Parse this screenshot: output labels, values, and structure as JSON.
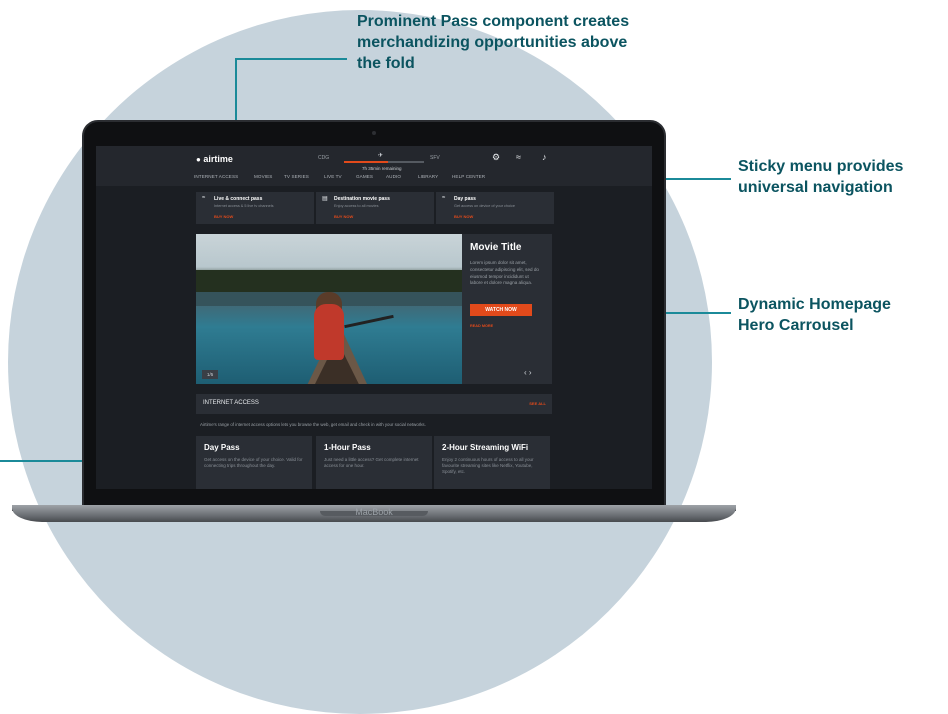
{
  "callouts": {
    "prominent_pass": [
      "Prominent Pass component creates",
      "merchandizing opportunities above",
      "the fold"
    ],
    "sticky_menu": [
      "Sticky menu provides",
      "universal navigation"
    ],
    "hero": [
      "Dynamic Homepage",
      "Hero Carrousel"
    ]
  },
  "laptop": {
    "brand": "MacBook"
  },
  "header": {
    "logo": "airtime",
    "flight": {
      "origin": "CDG",
      "destination": "SFV",
      "remaining": "7h 35min remaining",
      "progress": 0.55
    },
    "icons": [
      "gear-icon",
      "wifi-icon",
      "music-icon"
    ]
  },
  "nav": [
    "INTERNET ACCESS",
    "MOVIES",
    "TV SERIES",
    "LIVE TV",
    "GAMES",
    "AUDIO",
    "LIBRARY",
    "HELP CENTER"
  ],
  "passes": [
    {
      "icon": "wifi-icon",
      "title": "Live & connect pass",
      "desc": "Internet access & 5 live tv channels",
      "cta": "BUY NOW"
    },
    {
      "icon": "film-icon",
      "title": "Destination movie pass",
      "desc": "Enjoy access to all movies",
      "cta": "BUY NOW"
    },
    {
      "icon": "wifi-icon",
      "title": "Day pass",
      "desc": "Get access on device of your choice",
      "cta": "BUY NOW"
    }
  ],
  "hero": {
    "counter": "1/5",
    "title": "Movie Title",
    "desc": "Lorem ipsum dolor sit amet, consectetur adipiscing elit, sed do eiusmod tempor incididunt ut labore et dolore magna aliqua.",
    "watch_label": "WATCH NOW",
    "read_more": "READ MORE",
    "arrows": "‹ ›"
  },
  "internet_access": {
    "title": "INTERNET ACCESS",
    "see_all": "SEE ALL",
    "desc": "Airtime's range of internet access options lets you browse the web, get email and check in with your social networks.",
    "cards": [
      {
        "title": "Day Pass",
        "desc": "Get access on the device of your choice. Valid for connecting trips throughout the day."
      },
      {
        "title": "1-Hour Pass",
        "desc": "Just need a little access? Get complete internet access for one hour."
      },
      {
        "title": "2-Hour Streaming WiFi",
        "desc": "Enjoy 2 continuous hours of access to all your favourite streaming sites like Netflix, Youtube, Spotify, etc."
      }
    ]
  }
}
